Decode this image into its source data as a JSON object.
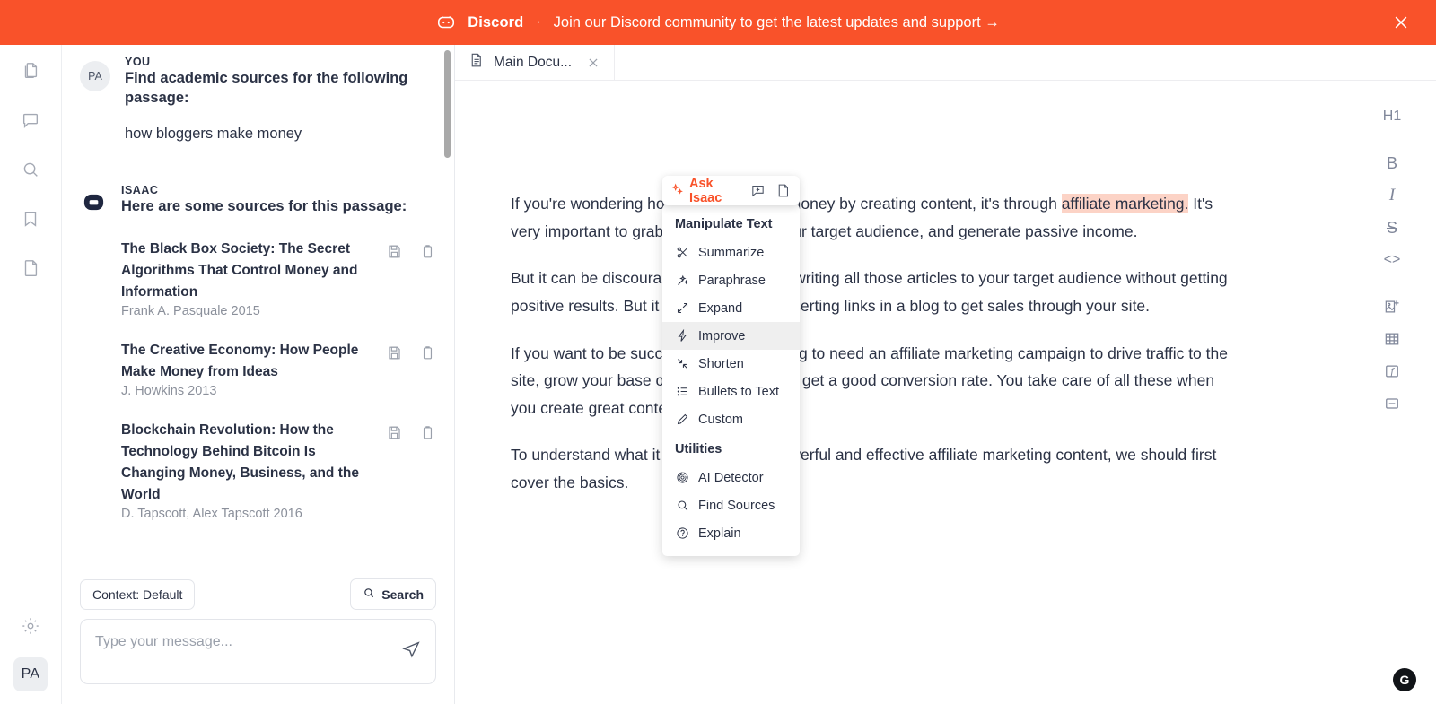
{
  "banner": {
    "icon": "discord-icon",
    "brand": "Discord",
    "separator": "·",
    "message": "Join our Discord community to get the latest updates and support →",
    "close_label": "×",
    "bg_color": "#f9522a"
  },
  "rail": {
    "items": [
      {
        "name": "documents-icon",
        "label": "Documents"
      },
      {
        "name": "chat-icon",
        "label": "Chat"
      },
      {
        "name": "search-icon",
        "label": "Search"
      },
      {
        "name": "bookmark-icon",
        "label": "Bookmarks"
      },
      {
        "name": "file-icon",
        "label": "Files"
      }
    ],
    "settings": {
      "name": "gear-icon",
      "label": "Settings"
    },
    "avatar": "PA"
  },
  "chat": {
    "messages": [
      {
        "author": "YOU",
        "avatar": "PA",
        "title": "Find academic sources for the following passage:",
        "text": "how bloggers make money"
      },
      {
        "author": "ISAAC",
        "avatar": "bot",
        "title": "Here are some sources for this passage:"
      }
    ],
    "sources": [
      {
        "title": "The Black Box Society: The Secret Algorithms That Control Money and Information",
        "meta": "Frank A. Pasquale 2015"
      },
      {
        "title": "The Creative Economy: How People Make Money from Ideas",
        "meta": "J. Howkins 2013"
      },
      {
        "title": "Blockchain Revolution: How the Technology Behind Bitcoin Is Changing Money, Business, and the World",
        "meta": "D. Tapscott, Alex Tapscott 2016"
      }
    ],
    "source_actions": {
      "save": "save-icon",
      "copy": "copy-icon"
    },
    "context_button": "Context: Default",
    "search_button": "Search",
    "composer_placeholder": "Type your message...",
    "composer_value": ""
  },
  "editor": {
    "tab": {
      "label": "Main Docu...",
      "icon": "document-icon",
      "close": "×"
    },
    "paragraphs": [
      {
        "pre": "If you're wondering how bloggers make money by creating content, it's through ",
        "highlight": "affiliate marketing.",
        "post": " It's very important to grab the attention of your target audience, and generate passive income."
      },
      {
        "pre": "But it can be discouraging when you are writing all those articles to your target audience without getting positive results. But it takes more than inserting links in a blog to get sales through your site.",
        "highlight": "",
        "post": ""
      },
      {
        "pre": "If you want to be successful, you are going to need an affiliate marketing campaign to drive traffic to the site, grow your base of loyal readers, and get a good conversion rate. You take care of all these when you create great content.",
        "highlight": "",
        "post": ""
      },
      {
        "pre": "To understand what it takes to create powerful and effective affiliate marketing content, we should first cover the basics.",
        "highlight": "",
        "post": ""
      }
    ],
    "highlight_color": "#fcd3c6"
  },
  "format_toolbar": [
    {
      "name": "heading-1-icon",
      "label": "H1"
    },
    {
      "name": "bold-icon",
      "label": "B"
    },
    {
      "name": "italic-icon",
      "label": "I"
    },
    {
      "name": "strikethrough-icon",
      "label": "S"
    },
    {
      "name": "code-icon",
      "label": "<>"
    },
    {
      "name": "insert-image-icon",
      "label": ""
    },
    {
      "name": "insert-table-icon",
      "label": ""
    },
    {
      "name": "formula-icon",
      "label": "f"
    },
    {
      "name": "horizontal-rule-icon",
      "label": ""
    }
  ],
  "float_toolbar": {
    "ask_isaac": "Ask Isaac",
    "sparkle_icon": "sparkle-icon",
    "comment_icon": "add-comment-icon",
    "page_icon": "page-icon",
    "accent_color": "#f9522a"
  },
  "menu": {
    "groups": [
      {
        "heading": "Manipulate Text",
        "items": [
          {
            "label": "Summarize",
            "icon": "scissors-icon",
            "active": false
          },
          {
            "label": "Paraphrase",
            "icon": "magic-wand-icon",
            "active": false
          },
          {
            "label": "Expand",
            "icon": "expand-arrows-icon",
            "active": false
          },
          {
            "label": "Improve",
            "icon": "lightning-bolt-icon",
            "active": true
          },
          {
            "label": "Shorten",
            "icon": "shrink-arrows-icon",
            "active": false
          },
          {
            "label": "Bullets to Text",
            "icon": "list-icon",
            "active": false
          },
          {
            "label": "Custom",
            "icon": "pencil-icon",
            "active": false
          }
        ]
      },
      {
        "heading": "Utilities",
        "items": [
          {
            "label": "AI Detector",
            "icon": "fingerprint-icon",
            "active": false
          },
          {
            "label": "Find Sources",
            "icon": "search-icon",
            "active": false
          },
          {
            "label": "Explain",
            "icon": "question-circle-icon",
            "active": false
          }
        ]
      }
    ],
    "highlight_bg": "#efefef"
  },
  "grammar_badge": {
    "label": "G"
  }
}
